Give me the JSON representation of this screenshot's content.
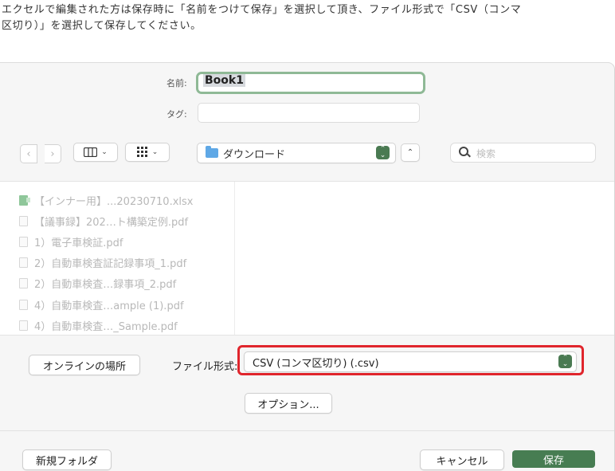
{
  "instruction": {
    "line1": "エクセルで編集された方は保存時に「名前をつけて保存」を選択して頂き、ファイル形式で「CSV（コンマ",
    "line2": "区切り）」を選択して保存してください。"
  },
  "dialog": {
    "name_label": "名前:",
    "name_value": "Book1",
    "tag_label": "タグ:",
    "location": "ダウンロード",
    "search_placeholder": "検索",
    "files": [
      {
        "name": "【インナー用】...20230710.xlsx",
        "icon": "excel-file-icon"
      },
      {
        "name": "【議事録】202…ト構築定例.pdf",
        "icon": "pdf-file-icon"
      },
      {
        "name": "1）電子車検証.pdf",
        "icon": "pdf-file-icon"
      },
      {
        "name": "2）自動車検査証記録事項_1.pdf",
        "icon": "pdf-file-icon"
      },
      {
        "name": "2）自動車検査…録事項_2.pdf",
        "icon": "pdf-file-icon"
      },
      {
        "name": "4）自動車検査…ample (1).pdf",
        "icon": "pdf-file-icon"
      },
      {
        "name": "4）自動車検査…_Sample.pdf",
        "icon": "pdf-file-icon"
      }
    ],
    "online_button": "オンラインの場所",
    "format_label": "ファイル形式:",
    "format_value": "CSV (コンマ区切り) (.csv)",
    "options_button": "オプション...",
    "new_folder_button": "新規フォルダ",
    "cancel_button": "キャンセル",
    "save_button": "保存"
  },
  "colors": {
    "accent_green": "#477d52",
    "highlight_red": "#e0252c",
    "name_focus_ring": "#8fb996"
  }
}
